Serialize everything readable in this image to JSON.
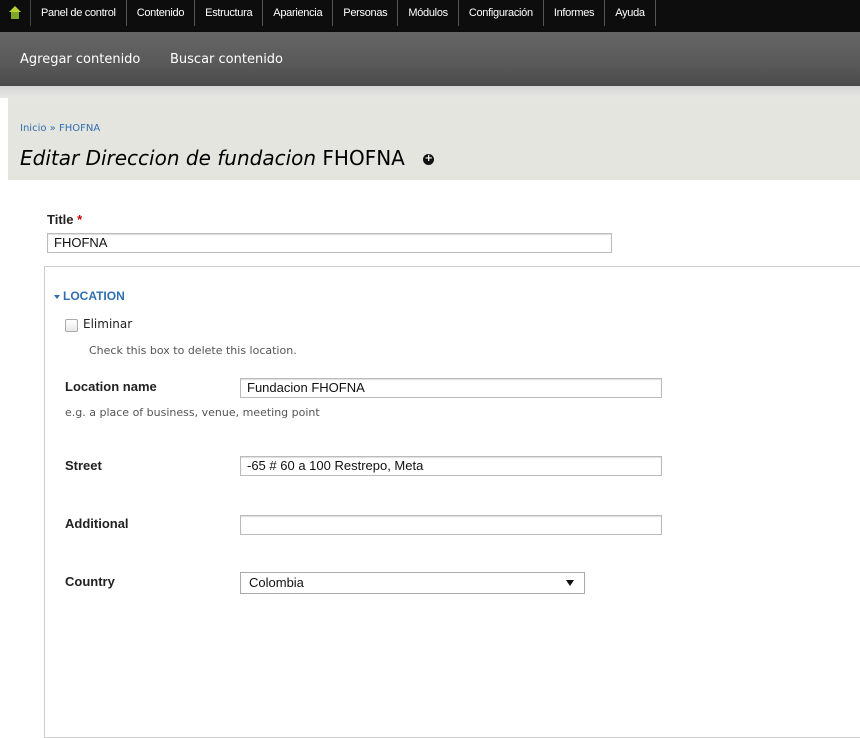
{
  "toolbar": {
    "home_icon": "home-icon",
    "items": [
      "Panel de control",
      "Contenido",
      "Estructura",
      "Apariencia",
      "Personas",
      "Módulos",
      "Configuración",
      "Informes",
      "Ayuda"
    ]
  },
  "shortcuts": {
    "items": [
      "Agregar contenido",
      "Buscar contenido"
    ]
  },
  "breadcrumb": {
    "home": "Inicio",
    "separator": "»",
    "current": "FHOFNA"
  },
  "page_title": {
    "italic": "Editar Direccion de fundacion",
    "name": "FHOFNA",
    "add_icon": "plus-circle-icon"
  },
  "form": {
    "title_label": "Title",
    "required_mark": "*",
    "title_value": "FHOFNA",
    "location": {
      "legend": "LOCATION",
      "delete_label": "Eliminar",
      "delete_desc": "Check this box to delete this location.",
      "name_label": "Location name",
      "name_value": "Fundacion FHOFNA",
      "name_desc": "e.g. a place of business, venue, meeting point",
      "street_label": "Street",
      "street_value": "-65 # 60 a 100 Restrepo, Meta",
      "additional_label": "Additional",
      "additional_value": "",
      "country_label": "Country",
      "country_value": "Colombia"
    }
  },
  "colors": {
    "link": "#2f6fb0",
    "toolbar_bg": "#0d0d0d",
    "required": "#cc0000"
  }
}
